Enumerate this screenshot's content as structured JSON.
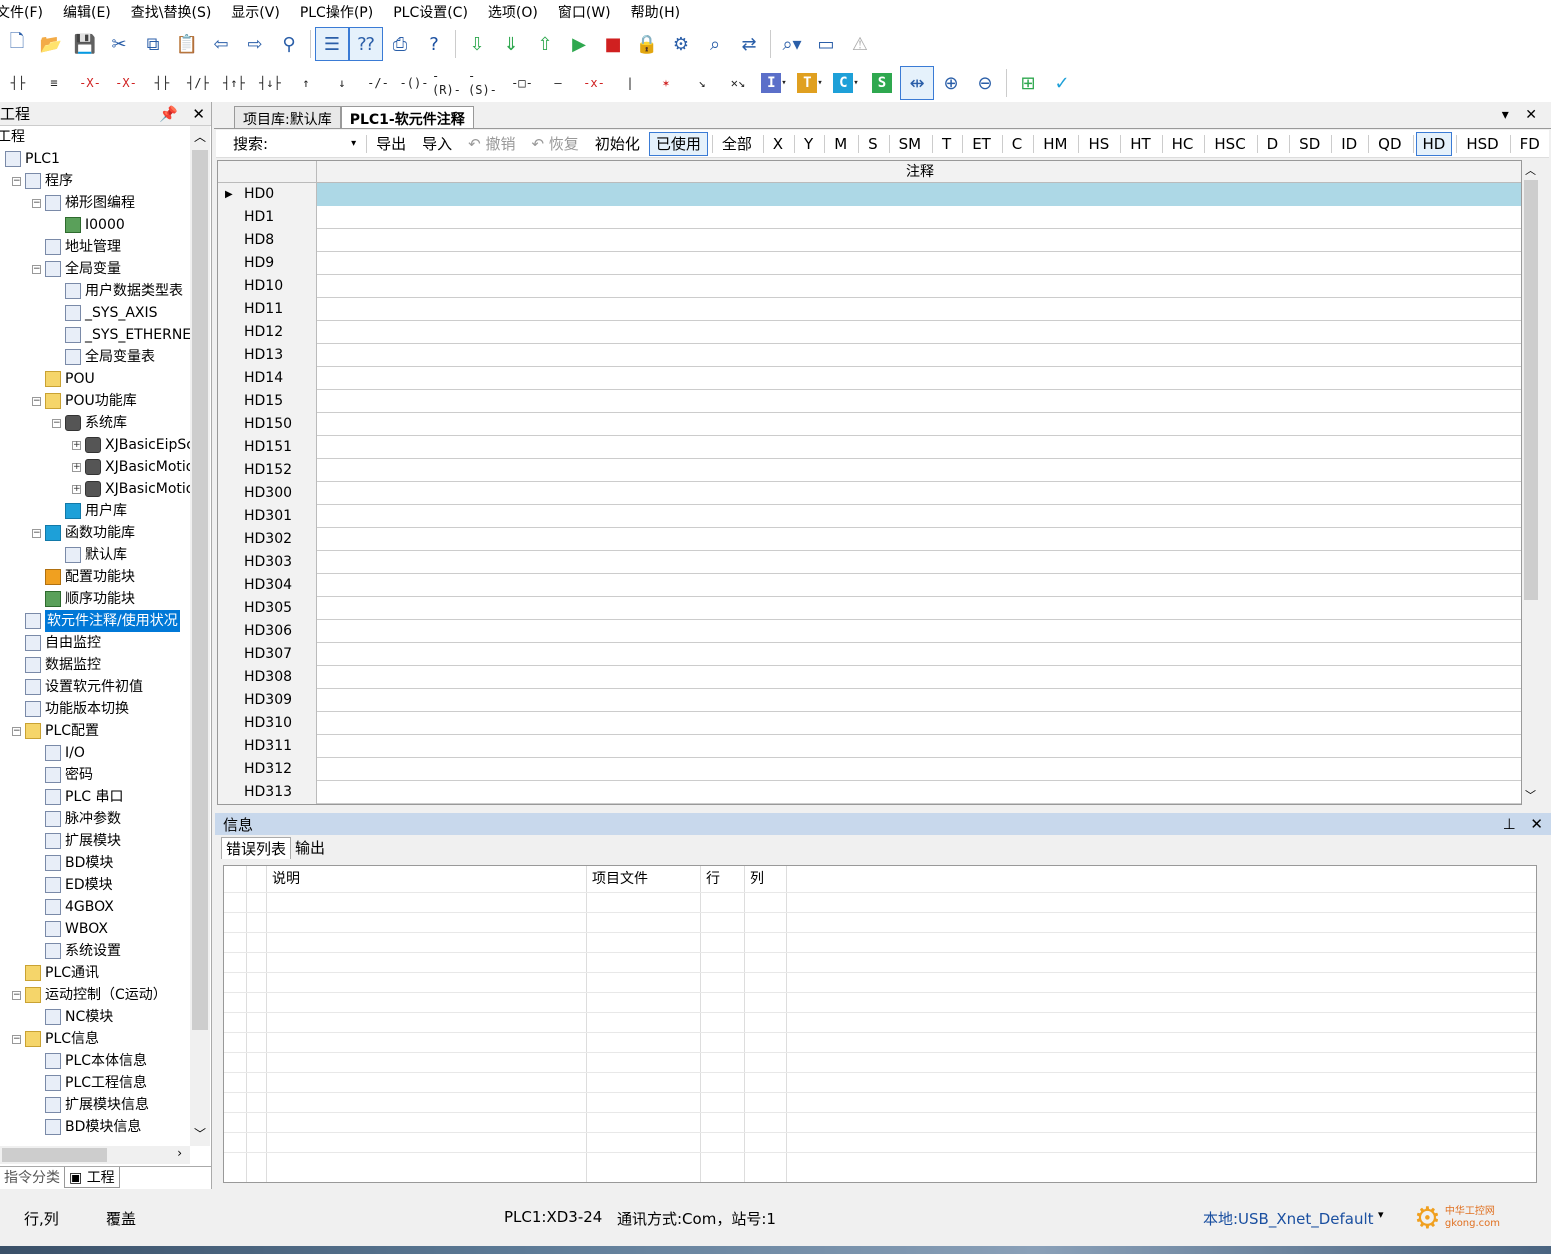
{
  "menu": [
    "文件(F)",
    "编辑(E)",
    "查找\\替换(S)",
    "显示(V)",
    "PLC操作(P)",
    "PLC设置(C)",
    "选项(O)",
    "窗口(W)",
    "帮助(H)"
  ],
  "toolbar1_icons": [
    "new-file-icon",
    "open-folder-icon",
    "save-icon",
    "cut-icon",
    "copy-icon",
    "paste-icon",
    "undo-icon",
    "redo-icon",
    "find-icon",
    "ladder-view-icon",
    "instruction-list-icon",
    "print-icon",
    "help-icon",
    "download-icon",
    "download-partial-icon",
    "upload-icon",
    "run-icon",
    "stop-icon",
    "lock-icon",
    "settings-icon",
    "monitor-icon",
    "compare-icon",
    "zoom-dropdown-icon",
    "communication-icon",
    "warning-icon"
  ],
  "toolbar2_glyphs": [
    "┤├",
    "≡",
    "-X-",
    "-X-",
    "┤├",
    "┤/├",
    "┤↑├",
    "┤↓├",
    "↑",
    "↓",
    "-/-",
    "-()-",
    "-(R)-",
    "-(S)-",
    "-□-",
    "—",
    "-x-",
    "|",
    "✶",
    "↘",
    "✕↘"
  ],
  "toolbar2_letters": [
    {
      "label": "I",
      "color": "#5b6fc9"
    },
    {
      "label": "T",
      "color": "#e0a020"
    },
    {
      "label": "C",
      "color": "#1ea0d8"
    },
    {
      "label": "S",
      "color": "#2fa84f"
    }
  ],
  "left_panel": {
    "title": "工程",
    "tabs": [
      "指令分类",
      "工程"
    ],
    "tree": [
      {
        "label": "工程",
        "level": 0,
        "icon": "none",
        "exp": ""
      },
      {
        "label": "PLC1",
        "level": 0,
        "icon": "plc",
        "exp": ""
      },
      {
        "label": "程序",
        "level": 1,
        "icon": "program",
        "exp": "-"
      },
      {
        "label": "梯形图编程",
        "level": 2,
        "icon": "ladder",
        "exp": "-"
      },
      {
        "label": "I0000",
        "level": 3,
        "icon": "green",
        "exp": ""
      },
      {
        "label": "地址管理",
        "level": 2,
        "icon": "addr",
        "exp": ""
      },
      {
        "label": "全局变量",
        "level": 2,
        "icon": "global",
        "exp": "-"
      },
      {
        "label": "用户数据类型表",
        "level": 3,
        "icon": "table",
        "exp": ""
      },
      {
        "label": "_SYS_AXIS",
        "level": 3,
        "icon": "global",
        "exp": ""
      },
      {
        "label": "_SYS_ETHERNE",
        "level": 3,
        "icon": "global",
        "exp": ""
      },
      {
        "label": "全局变量表",
        "level": 3,
        "icon": "global",
        "exp": ""
      },
      {
        "label": "POU",
        "level": 2,
        "icon": "folder",
        "exp": ""
      },
      {
        "label": "POU功能库",
        "level": 2,
        "icon": "folder",
        "exp": "-"
      },
      {
        "label": "系统库",
        "level": 3,
        "icon": "db",
        "exp": "-"
      },
      {
        "label": "XJBasicEipSc",
        "level": 4,
        "icon": "db",
        "exp": "+"
      },
      {
        "label": "XJBasicMotior",
        "level": 4,
        "icon": "db",
        "exp": "+"
      },
      {
        "label": "XJBasicMotior",
        "level": 4,
        "icon": "db",
        "exp": "+"
      },
      {
        "label": "用户库",
        "level": 3,
        "icon": "blue",
        "exp": ""
      },
      {
        "label": "函数功能库",
        "level": 2,
        "icon": "blue",
        "exp": "-"
      },
      {
        "label": "默认库",
        "level": 3,
        "icon": "table",
        "exp": ""
      },
      {
        "label": "配置功能块",
        "level": 2,
        "icon": "orange",
        "exp": ""
      },
      {
        "label": "顺序功能块",
        "level": 2,
        "icon": "green",
        "exp": ""
      },
      {
        "label": "软元件注释/使用状况",
        "level": 1,
        "icon": "table",
        "exp": "",
        "selected": true
      },
      {
        "label": "自由监控",
        "level": 1,
        "icon": "addr",
        "exp": ""
      },
      {
        "label": "数据监控",
        "level": 1,
        "icon": "addr",
        "exp": ""
      },
      {
        "label": "设置软元件初值",
        "level": 1,
        "icon": "table",
        "exp": ""
      },
      {
        "label": "功能版本切换",
        "level": 1,
        "icon": "addr",
        "exp": ""
      },
      {
        "label": "PLC配置",
        "level": 1,
        "icon": "folder",
        "exp": "-"
      },
      {
        "label": "I/O",
        "level": 2,
        "icon": "addr",
        "exp": ""
      },
      {
        "label": "密码",
        "level": 2,
        "icon": "addr",
        "exp": ""
      },
      {
        "label": "PLC 串口",
        "level": 2,
        "icon": "addr",
        "exp": ""
      },
      {
        "label": "脉冲参数",
        "level": 2,
        "icon": "addr",
        "exp": ""
      },
      {
        "label": "扩展模块",
        "level": 2,
        "icon": "addr",
        "exp": ""
      },
      {
        "label": "BD模块",
        "level": 2,
        "icon": "addr",
        "exp": ""
      },
      {
        "label": "ED模块",
        "level": 2,
        "icon": "addr",
        "exp": ""
      },
      {
        "label": "4GBOX",
        "level": 2,
        "icon": "addr",
        "exp": ""
      },
      {
        "label": "WBOX",
        "level": 2,
        "icon": "addr",
        "exp": ""
      },
      {
        "label": "系统设置",
        "level": 2,
        "icon": "addr",
        "exp": ""
      },
      {
        "label": "PLC通讯",
        "level": 1,
        "icon": "folder",
        "exp": ""
      },
      {
        "label": "运动控制（C运动）",
        "level": 1,
        "icon": "folder",
        "exp": "-"
      },
      {
        "label": "NC模块",
        "level": 2,
        "icon": "addr",
        "exp": ""
      },
      {
        "label": "PLC信息",
        "level": 1,
        "icon": "folder",
        "exp": "-"
      },
      {
        "label": "PLC本体信息",
        "level": 2,
        "icon": "addr",
        "exp": ""
      },
      {
        "label": "PLC工程信息",
        "level": 2,
        "icon": "addr",
        "exp": ""
      },
      {
        "label": "扩展模块信息",
        "level": 2,
        "icon": "addr",
        "exp": ""
      },
      {
        "label": "BD模块信息",
        "level": 2,
        "icon": "addr",
        "exp": ""
      }
    ]
  },
  "doc_tabs": [
    "项目库:默认库",
    "PLC1-软元件注释"
  ],
  "filter": {
    "search_label": "搜索:",
    "actions": [
      "导出",
      "导入"
    ],
    "disabled": [
      "撤销",
      "恢复"
    ],
    "init": "初始化",
    "used": "已使用",
    "all": "全部",
    "types": [
      "X",
      "Y",
      "M",
      "S",
      "SM",
      "T",
      "ET",
      "C",
      "HM",
      "HS",
      "HT",
      "HC",
      "HSC",
      "D",
      "SD",
      "ID",
      "QD",
      "HD",
      "HSD",
      "FD"
    ],
    "selected_type": "HD"
  },
  "grid": {
    "column_header": "注释",
    "rows": [
      "HD0",
      "HD1",
      "HD8",
      "HD9",
      "HD10",
      "HD11",
      "HD12",
      "HD13",
      "HD14",
      "HD15",
      "HD150",
      "HD151",
      "HD152",
      "HD300",
      "HD301",
      "HD302",
      "HD303",
      "HD304",
      "HD305",
      "HD306",
      "HD307",
      "HD308",
      "HD309",
      "HD310",
      "HD311",
      "HD312",
      "HD313"
    ],
    "current_row": "HD0"
  },
  "info_panel": {
    "title": "信息",
    "tabs": [
      "错误列表",
      "输出"
    ],
    "columns": [
      "说明",
      "项目文件",
      "行",
      "列"
    ]
  },
  "status": {
    "rowcol": "行,列",
    "mode": "覆盖",
    "plc": "PLC1:XD3-24",
    "comm": "通讯方式:Com，站号:1",
    "connection": "本地:USB_Xnet_Default"
  },
  "watermark": "中华工控网 gkong.com"
}
